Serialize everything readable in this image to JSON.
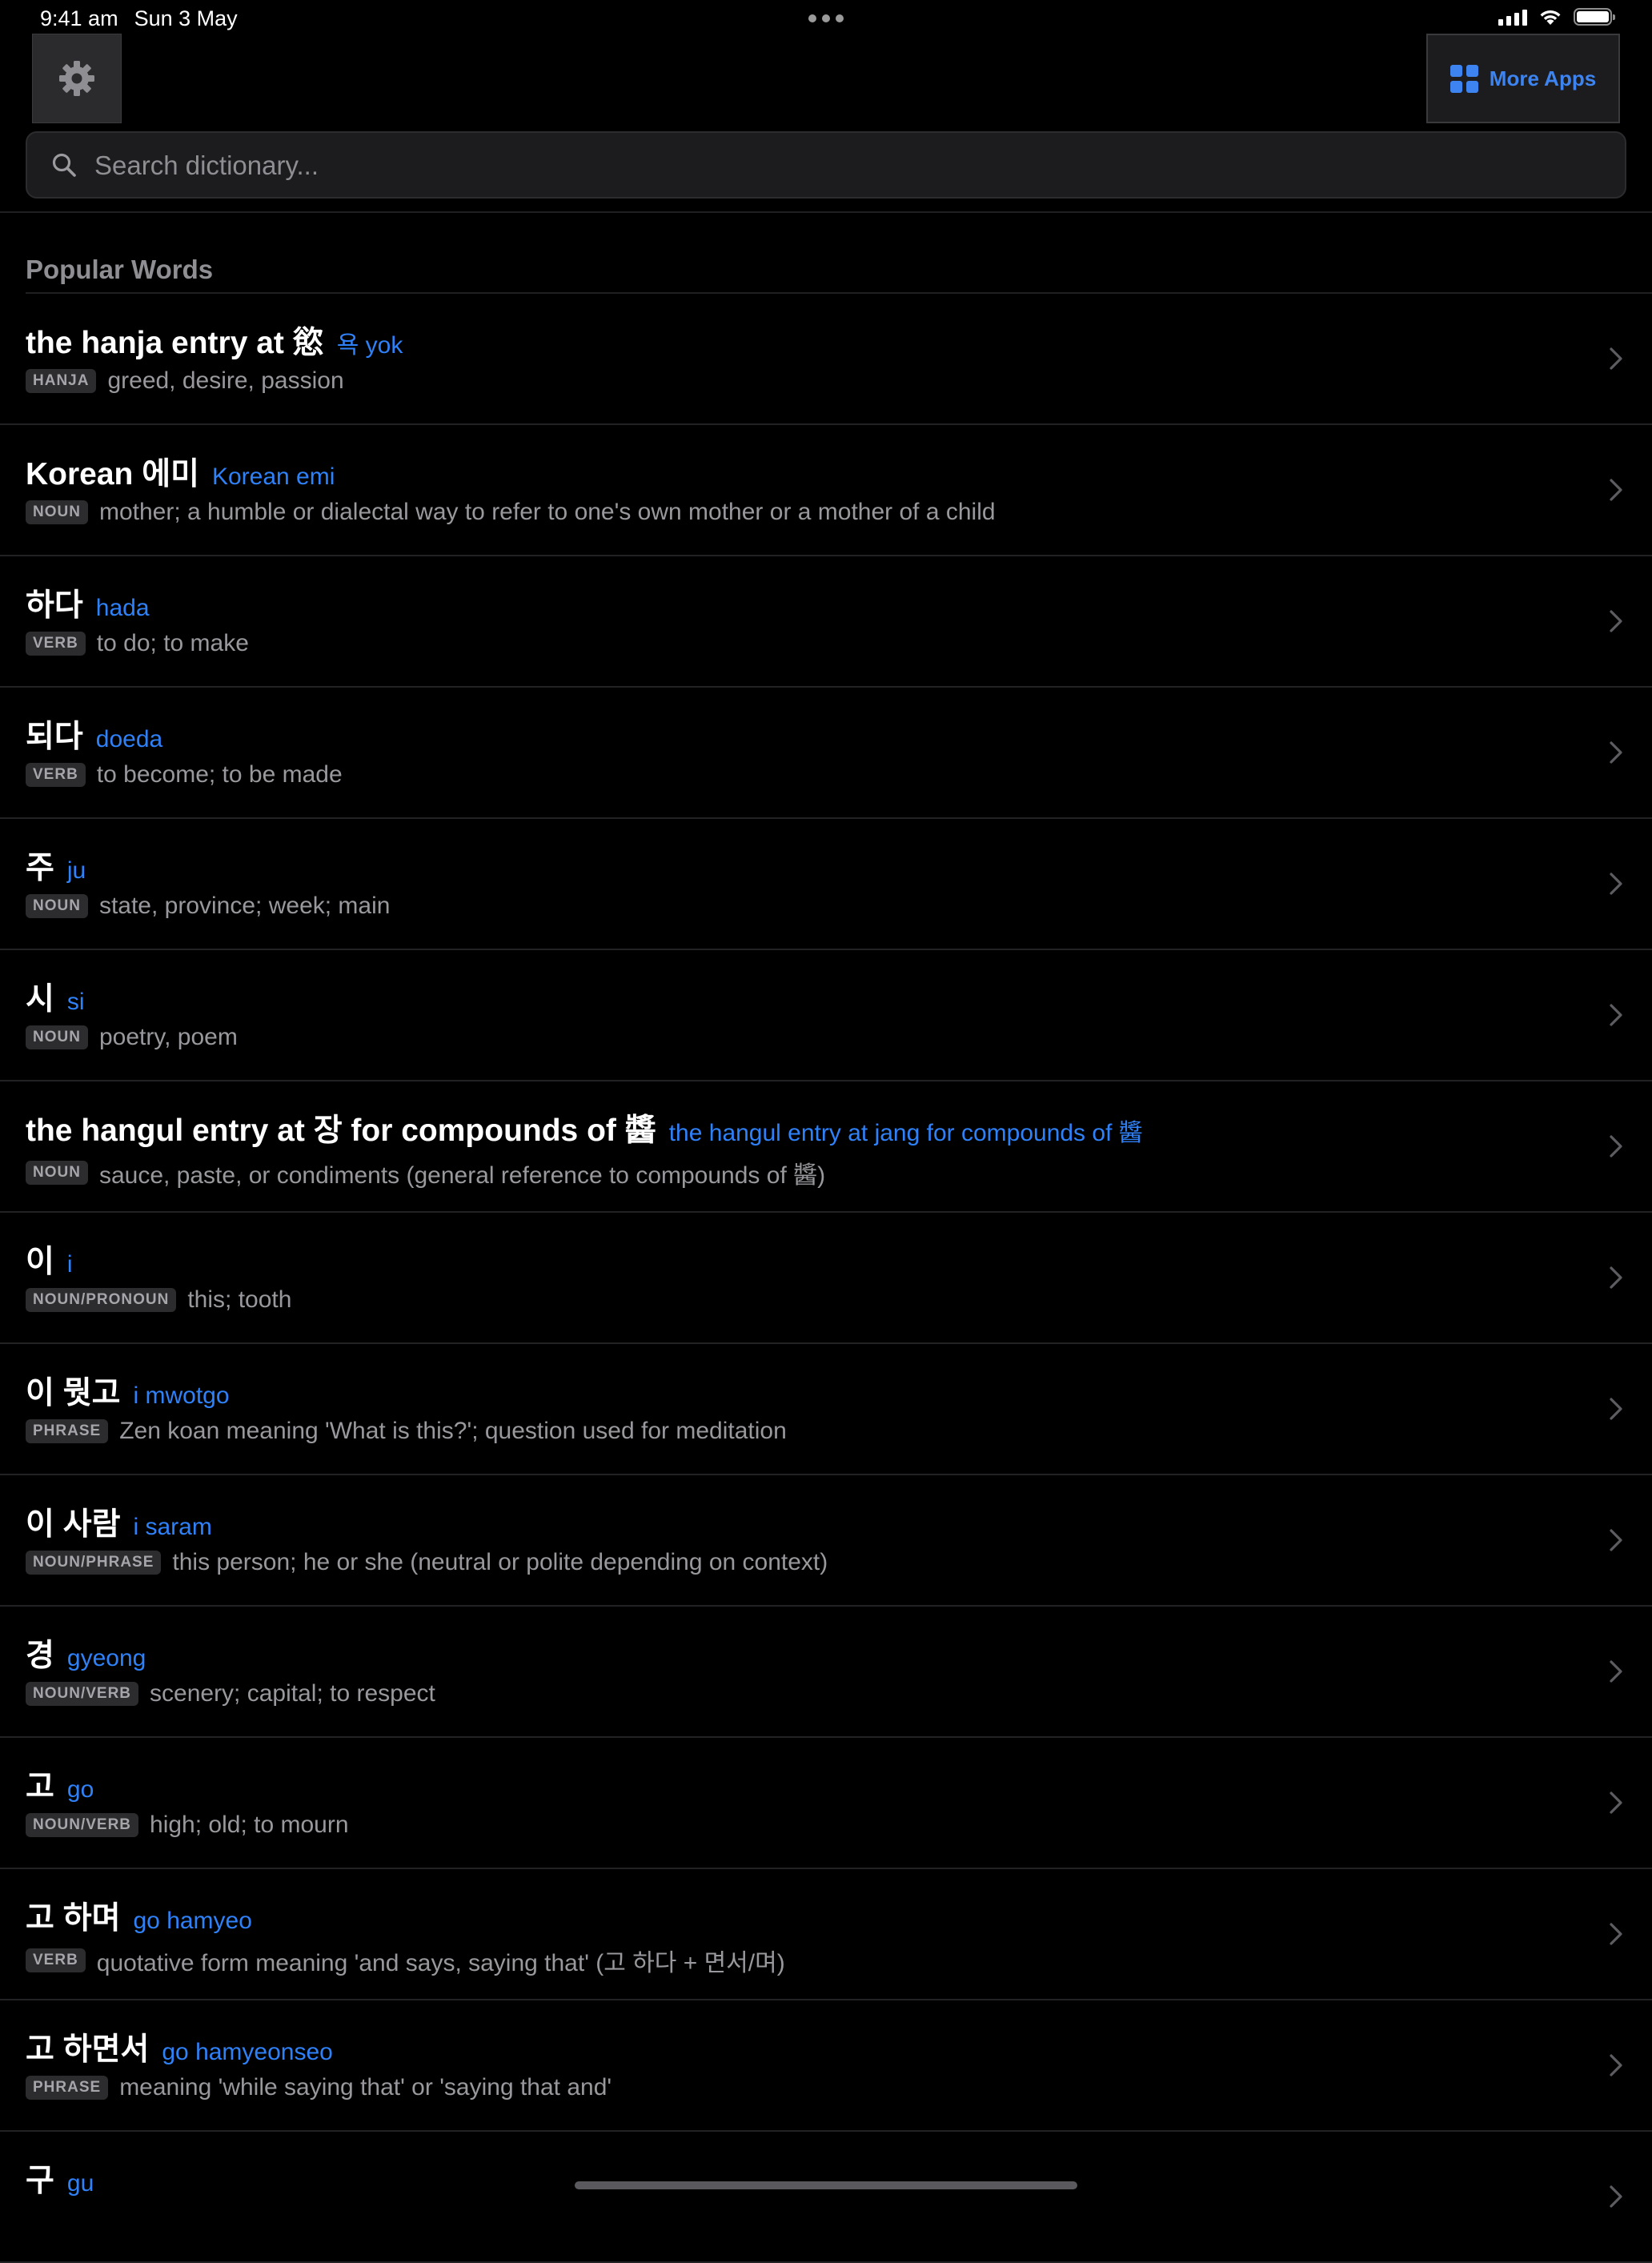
{
  "status_bar": {
    "time": "9:41 am",
    "date": "Sun 3 May"
  },
  "header": {
    "settings_icon": "gear-icon",
    "more_apps_label": "More Apps",
    "more_apps_icon": "grid-icon"
  },
  "search": {
    "placeholder": "Search dictionary...",
    "value": ""
  },
  "section": {
    "title": "Popular Words"
  },
  "colors": {
    "background": "#000000",
    "accent": "#2f81f7",
    "secondary_text": "#98989d",
    "badge_bg": "#2c2c2e"
  },
  "words": [
    {
      "term": "the hanja entry at 慾",
      "romanization": "욕 yok",
      "pos": "HANJA",
      "definition": "greed, desire, passion"
    },
    {
      "term": "Korean 에미",
      "romanization": "Korean emi",
      "pos": "NOUN",
      "definition": "mother; a humble or dialectal way to refer to one's own mother or a mother of a child"
    },
    {
      "term": "하다",
      "romanization": "hada",
      "pos": "VERB",
      "definition": "to do; to make"
    },
    {
      "term": "되다",
      "romanization": "doeda",
      "pos": "VERB",
      "definition": "to become; to be made"
    },
    {
      "term": "주",
      "romanization": "ju",
      "pos": "NOUN",
      "definition": "state, province; week; main"
    },
    {
      "term": "시",
      "romanization": "si",
      "pos": "NOUN",
      "definition": "poetry, poem"
    },
    {
      "term": "the hangul entry at 장 for compounds of 醬",
      "romanization": "the hangul entry at jang for compounds of 醬",
      "pos": "NOUN",
      "definition": "sauce, paste, or condiments (general reference to compounds of 醬)"
    },
    {
      "term": "이",
      "romanization": "i",
      "pos": "NOUN/PRONOUN",
      "definition": "this; tooth"
    },
    {
      "term": "이 뭣고",
      "romanization": "i mwotgo",
      "pos": "PHRASE",
      "definition": "Zen koan meaning 'What is this?'; question used for meditation"
    },
    {
      "term": "이 사람",
      "romanization": "i saram",
      "pos": "NOUN/PHRASE",
      "definition": "this person; he or she (neutral or polite depending on context)"
    },
    {
      "term": "경",
      "romanization": "gyeong",
      "pos": "NOUN/VERB",
      "definition": "scenery; capital; to respect"
    },
    {
      "term": "고",
      "romanization": "go",
      "pos": "NOUN/VERB",
      "definition": "high; old; to mourn"
    },
    {
      "term": "고 하며",
      "romanization": "go hamyeo",
      "pos": "VERB",
      "definition": "quotative form meaning 'and says, saying that' (고 하다 + 면서/며)"
    },
    {
      "term": "고 하면서",
      "romanization": "go hamyeonseo",
      "pos": "PHRASE",
      "definition": "meaning 'while saying that' or 'saying that and'"
    },
    {
      "term": "구",
      "romanization": "gu",
      "pos": "",
      "definition": ""
    }
  ]
}
